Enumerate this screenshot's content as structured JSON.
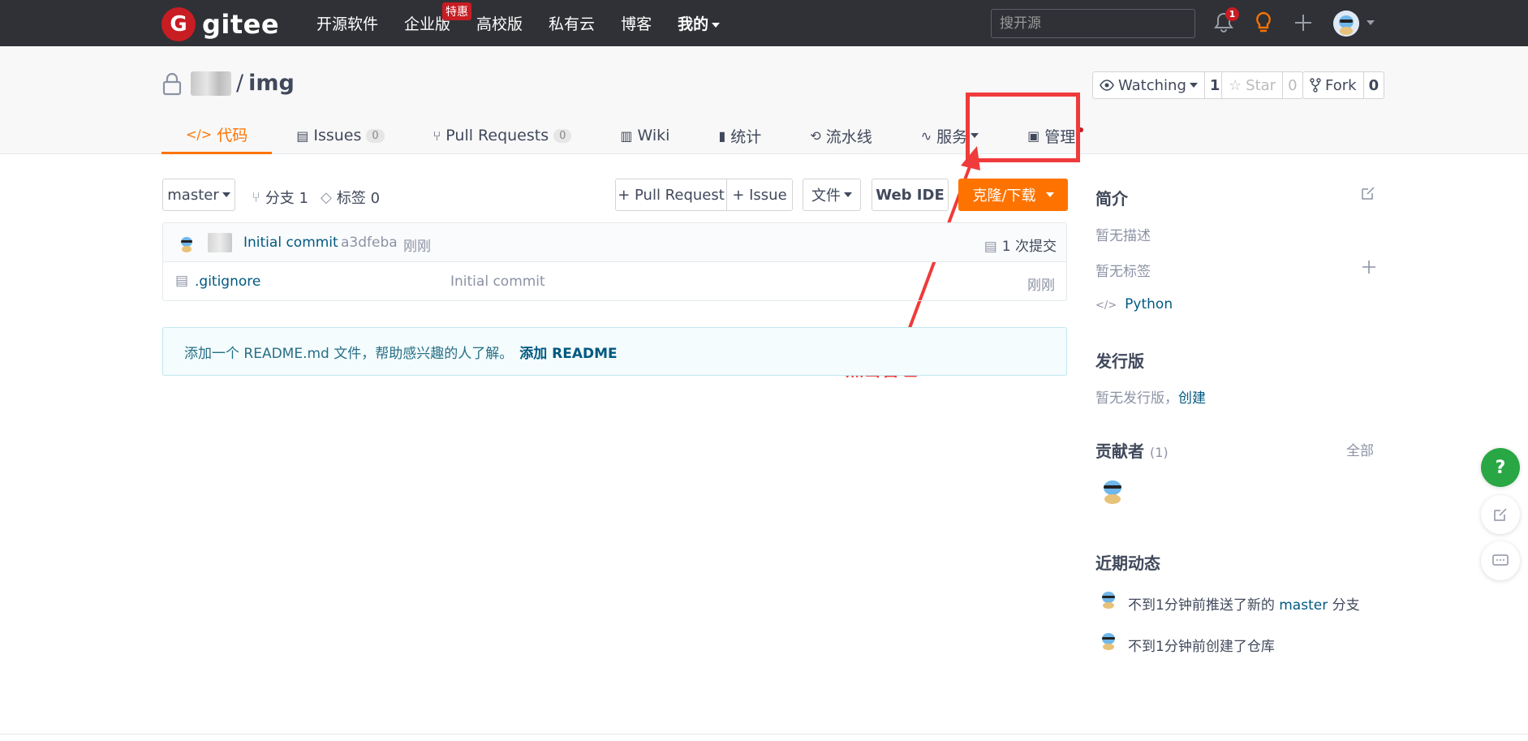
{
  "nav": {
    "logo_text": "gitee",
    "items": [
      "开源软件",
      "企业版",
      "高校版",
      "私有云",
      "博客",
      "我的"
    ],
    "enterprise_badge": "特惠",
    "search_placeholder": "搜开源",
    "notification_count": "1"
  },
  "repo": {
    "name": "img",
    "separator": "/",
    "watch_label": "Watching",
    "watch_count": "1",
    "star_label": "Star",
    "star_count": "0",
    "fork_label": "Fork",
    "fork_count": "0"
  },
  "tabs": [
    {
      "label": "代码",
      "icon": "code-icon"
    },
    {
      "label": "Issues",
      "count": "0",
      "icon": "issues-icon"
    },
    {
      "label": "Pull Requests",
      "count": "0",
      "icon": "pull-request-icon"
    },
    {
      "label": "Wiki",
      "icon": "wiki-icon"
    },
    {
      "label": "统计",
      "icon": "stats-icon"
    },
    {
      "label": "流水线",
      "icon": "pipeline-icon"
    },
    {
      "label": "服务",
      "icon": "service-icon"
    },
    {
      "label": "管理",
      "icon": "manage-icon"
    }
  ],
  "toolbar": {
    "branch": "master",
    "branches": "分支 1",
    "tags": "标签 0",
    "pull_request": "+ Pull Request",
    "issue": "+ Issue",
    "file": "文件",
    "web_ide": "Web IDE",
    "clone": "克隆/下载"
  },
  "commit": {
    "message": "Initial commit",
    "hash": "a3dfeba",
    "time": "刚刚",
    "count": "1 次提交"
  },
  "files": [
    {
      "name": ".gitignore",
      "message": "Initial commit",
      "time": "刚刚"
    }
  ],
  "readme": {
    "text": "添加一个 README.md 文件，帮助感兴趣的人了解。",
    "link": "添加 README"
  },
  "annotation": "点击管理",
  "sidebar": {
    "intro_title": "简介",
    "no_desc": "暂无描述",
    "no_tags": "暂无标签",
    "language": "Python",
    "release_title": "发行版",
    "no_release": "暂无发行版，",
    "create": "创建",
    "contributors_title": "贡献者",
    "contributors_count": "(1)",
    "all": "全部",
    "activity_title": "近期动态",
    "activity_1_pre": "不到1分钟前推送了新的 ",
    "activity_1_branch": "master",
    "activity_1_post": " 分支",
    "activity_2": "不到1分钟前创建了仓库"
  },
  "colors": {
    "nav_bg": "#2f3136",
    "brand_red": "#c71d23",
    "accent_orange": "#fe7300",
    "highlight_red": "#ef3b3b",
    "link_blue": "#005980"
  }
}
